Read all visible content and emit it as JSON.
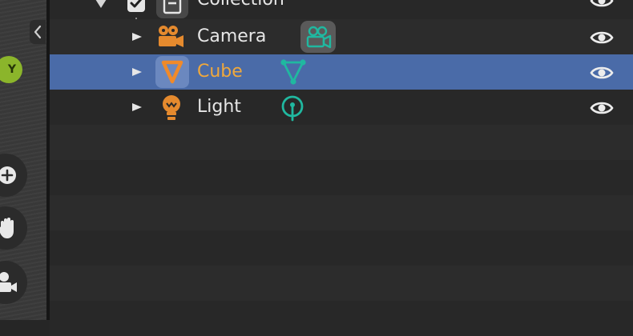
{
  "colors": {
    "selected_row": "#4a6ba8",
    "active_text": "#f0a83c",
    "object_orange": "#e58a2e",
    "data_teal": "#20b8a0",
    "text": "#e6e6e6"
  },
  "viewport": {
    "gizmo_axis_label": "Y",
    "icons": [
      "collapse-arrow-icon",
      "zoom-icon",
      "pan-hand-icon",
      "camera-view-icon"
    ]
  },
  "outliner": {
    "collection": {
      "name": "Collection",
      "checked": true,
      "visible": true
    },
    "items": [
      {
        "name": "Camera",
        "type": "camera",
        "data_icon": "camera-data-icon",
        "visible": true,
        "selected": false
      },
      {
        "name": "Cube",
        "type": "mesh",
        "data_icon": "mesh-data-icon",
        "visible": true,
        "selected": true
      },
      {
        "name": "Light",
        "type": "light",
        "data_icon": "light-data-icon",
        "visible": true,
        "selected": false
      }
    ]
  }
}
